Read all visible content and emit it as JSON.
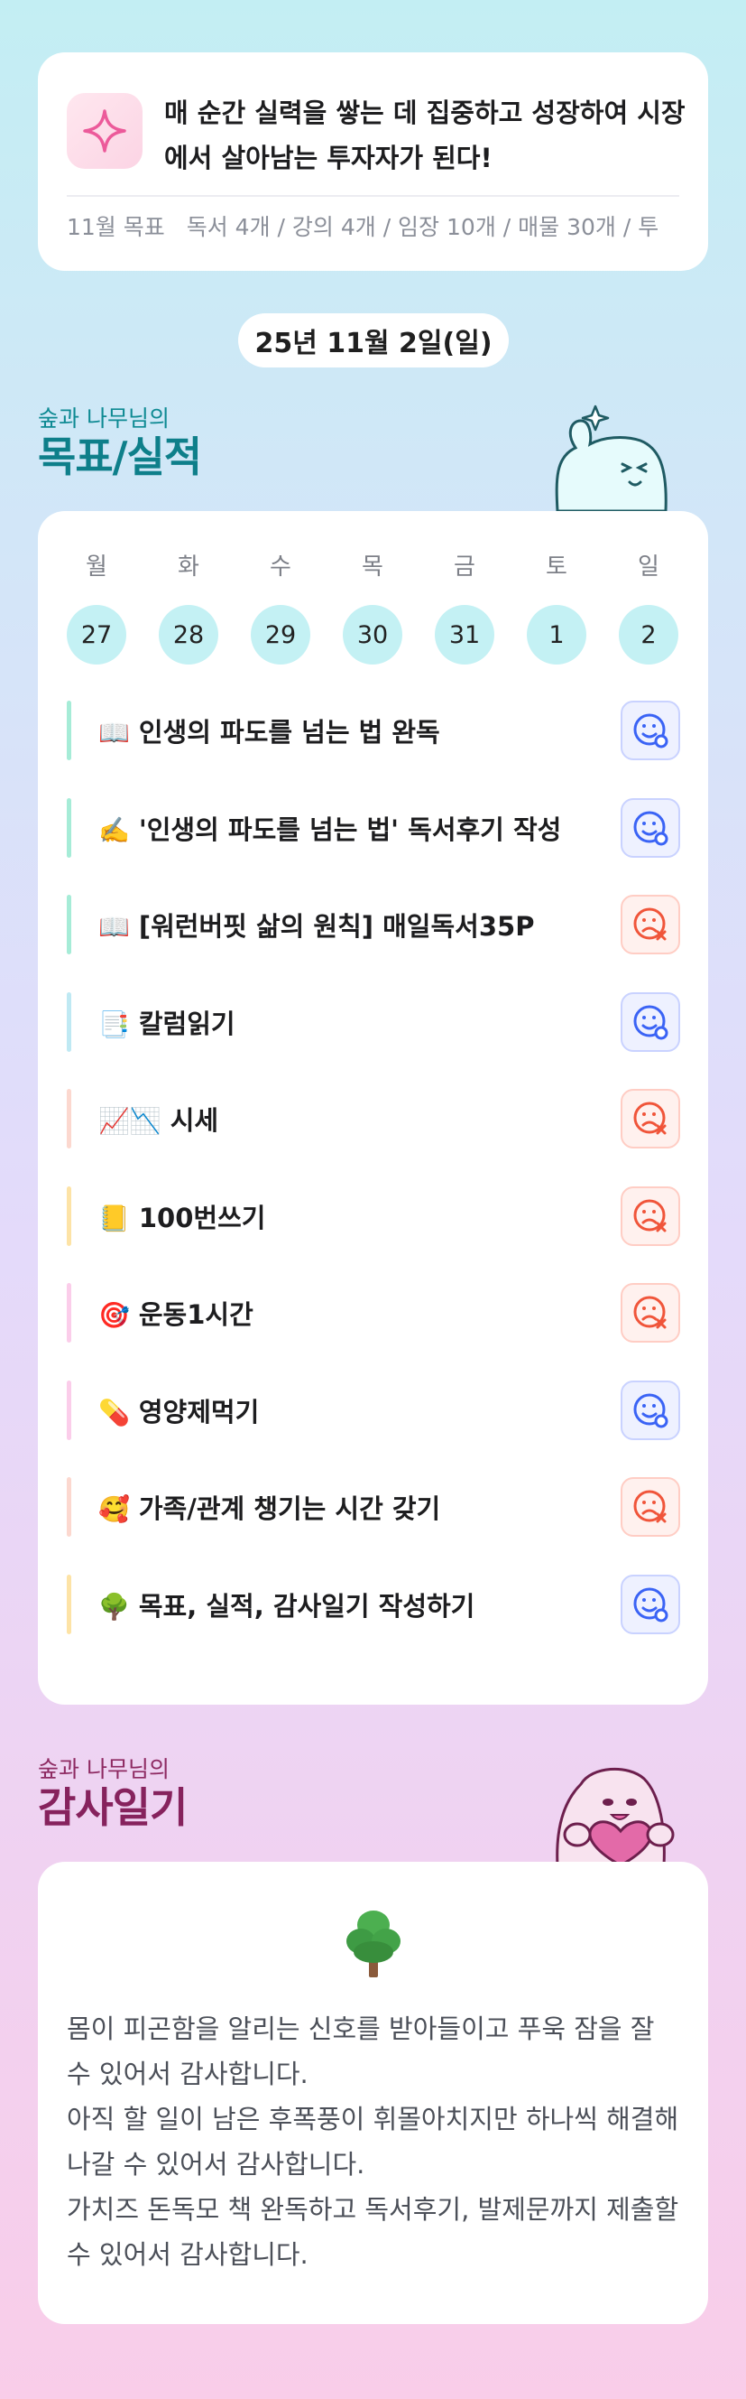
{
  "goal": {
    "text": "매 순간 실력을 쌓는 데 집중하고 성장하여 시장에서 살아남는 투자자가 된다!",
    "month_label": "11월 목표",
    "targets": "독서 4개 / 강의 4개 / 임장 10개 / 매물 30개 / 투"
  },
  "date": "25년 11월 2일(일)",
  "section1": {
    "sub": "숲과 나무님의",
    "title": "목표/실적"
  },
  "week": [
    {
      "name": "월",
      "num": "27"
    },
    {
      "name": "화",
      "num": "28"
    },
    {
      "name": "수",
      "num": "29"
    },
    {
      "name": "목",
      "num": "30"
    },
    {
      "name": "금",
      "num": "31"
    },
    {
      "name": "토",
      "num": "1"
    },
    {
      "name": "일",
      "num": "2"
    }
  ],
  "tasks": [
    {
      "emoji": "📖",
      "label": "인생의 파도를 넘는 법 완독",
      "status": "ok",
      "color": "#a6ecd7"
    },
    {
      "emoji": "✍️",
      "label": "'인생의 파도를 넘는 법' 독서후기 작성",
      "status": "ok",
      "color": "#a6ecd7"
    },
    {
      "emoji": "📖",
      "label": "[워런버핏 삶의 원칙] 매일독서35P",
      "status": "fail",
      "color": "#a6ecd7"
    },
    {
      "emoji": "📑",
      "label": "칼럼읽기",
      "status": "ok",
      "color": "#bfe9f3"
    },
    {
      "emoji": "📈📉",
      "label": "시세",
      "status": "fail",
      "color": "#fcd8cf"
    },
    {
      "emoji": "📒",
      "label": "100번쓰기",
      "status": "fail",
      "color": "#fde3a6"
    },
    {
      "emoji": "🎯",
      "label": "운동1시간",
      "status": "fail",
      "color": "#fbcdea"
    },
    {
      "emoji": "💊",
      "label": "영양제먹기",
      "status": "ok",
      "color": "#fbcdea"
    },
    {
      "emoji": "🥰",
      "label": "가족/관계 챙기는 시간 갖기",
      "status": "fail",
      "color": "#fcd8cf"
    },
    {
      "emoji": "🌳",
      "label": "목표, 실적, 감사일기 작성하기",
      "status": "ok",
      "color": "#fde3a6"
    }
  ],
  "section2": {
    "sub": "숲과 나무님의",
    "title": "감사일기"
  },
  "gratitude": {
    "lines": [
      "몸이 피곤함을 알리는 신호를 받아들이고 푸욱 잠을 잘 수 있어서 감사합니다.",
      "아직 할 일이 남은 후폭풍이 휘몰아치지만 하나씩 해결해 나갈 수 있어서 감사합니다.",
      "가치즈 돈독모 책 완독하고 독서후기, 발제문까지 제출할 수 있어서 감사합니다."
    ]
  },
  "colors": {
    "ok": "#3a63f5",
    "fail": "#f0553a",
    "teal": "#0e7f8a",
    "plum": "#86225d"
  }
}
